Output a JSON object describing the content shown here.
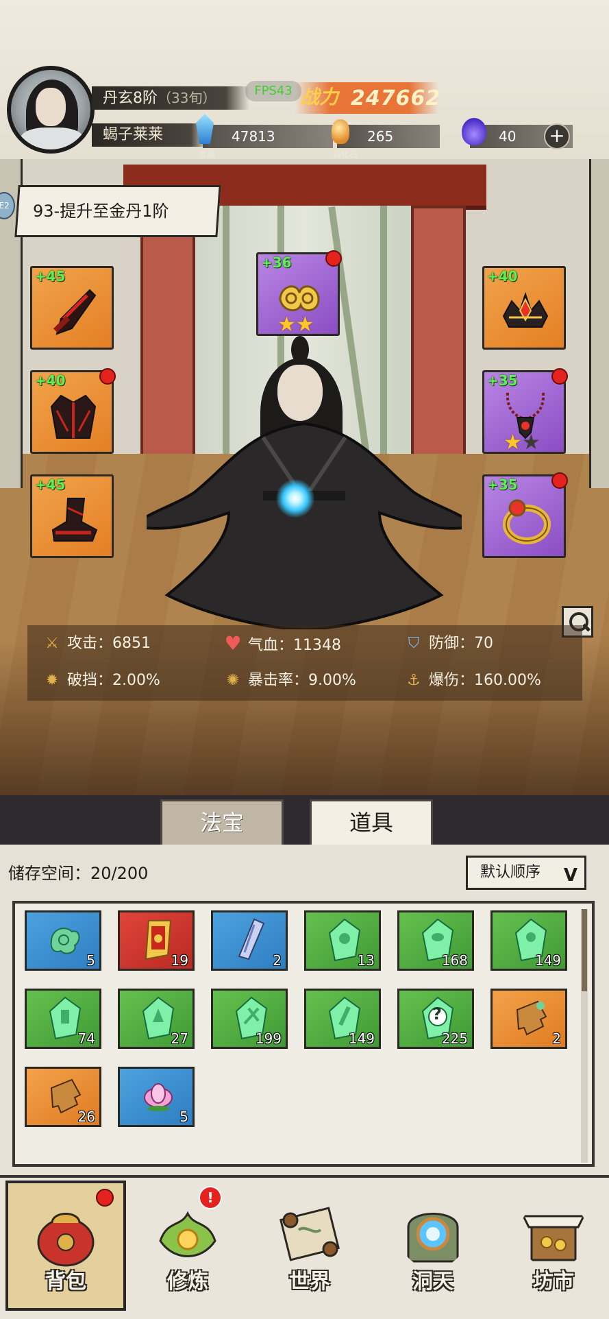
{
  "header": {
    "realm": "丹玄8阶",
    "age": "（33旬）",
    "nickname": "蝎子莱莱",
    "fps": "FPS43",
    "power_label": "战力",
    "power_value": "247662",
    "resources": [
      {
        "name": "灵晶",
        "value": "47813",
        "icon": "spirit-crystal-icon"
      },
      {
        "name": "造化石",
        "value": "265",
        "icon": "creation-stone-icon"
      },
      {
        "name": "",
        "value": "40",
        "icon": "purple-flame-icon"
      }
    ],
    "add_label": "+"
  },
  "quest": {
    "text": "93-提升至金丹1阶",
    "side_badge": "E2"
  },
  "equipment": [
    {
      "slot": "weapon",
      "level": "+45",
      "color": "#e9882b",
      "red_dot": false,
      "stars": 0
    },
    {
      "slot": "armor",
      "level": "+40",
      "color": "#e9882b",
      "red_dot": true,
      "stars": 0
    },
    {
      "slot": "boots",
      "level": "+45",
      "color": "#e9882b",
      "red_dot": false,
      "stars": 0
    },
    {
      "slot": "talisman",
      "level": "+36",
      "color": "#9a5fd0",
      "red_dot": true,
      "stars": 2
    },
    {
      "slot": "crown",
      "level": "+40",
      "color": "#e9882b",
      "red_dot": false,
      "stars": 0
    },
    {
      "slot": "necklace",
      "level": "+35",
      "color": "#9a5fd0",
      "red_dot": true,
      "stars": 1
    },
    {
      "slot": "ring",
      "level": "+35",
      "color": "#9a5fd0",
      "red_dot": true,
      "stars": 0
    }
  ],
  "stats": [
    {
      "label": "攻击：",
      "value": "6851",
      "icon": "sword-icon"
    },
    {
      "label": "气血：",
      "value": "11348",
      "icon": "heart-icon"
    },
    {
      "label": "防御：",
      "value": "70",
      "icon": "shield-icon"
    },
    {
      "label": "破挡：",
      "value": "2.00%",
      "icon": "break-icon"
    },
    {
      "label": "暴击率：",
      "value": "9.00%",
      "icon": "crit-icon"
    },
    {
      "label": "爆伤：",
      "value": "160.00%",
      "icon": "crit-damage-icon"
    }
  ],
  "tabs": [
    {
      "label": "法宝",
      "active": false
    },
    {
      "label": "道具",
      "active": true
    }
  ],
  "inventory": {
    "storage_label": "储存空间：",
    "storage_value": "20/200",
    "sort_label": "默认顺序",
    "items": [
      {
        "color": "blue",
        "count": "5",
        "icon": "jade-cloud-icon"
      },
      {
        "color": "red",
        "count": "19",
        "icon": "scroll-seal-icon"
      },
      {
        "color": "blue",
        "count": "2",
        "icon": "blade-icon"
      },
      {
        "color": "green",
        "count": "13",
        "icon": "green-gem-icon"
      },
      {
        "color": "green",
        "count": "168",
        "icon": "green-gem-icon"
      },
      {
        "color": "green",
        "count": "149",
        "icon": "green-gem-icon"
      },
      {
        "color": "green",
        "count": "74",
        "icon": "green-gem-icon"
      },
      {
        "color": "green",
        "count": "27",
        "icon": "green-gem-icon"
      },
      {
        "color": "green",
        "count": "199",
        "icon": "green-gem-icon"
      },
      {
        "color": "green",
        "count": "149",
        "icon": "green-gem-icon"
      },
      {
        "color": "green",
        "count": "225",
        "icon": "mystery-gem-icon",
        "glyph": "?"
      },
      {
        "color": "orange",
        "count": "2",
        "icon": "puzzle-piece-icon"
      },
      {
        "color": "orange",
        "count": "26",
        "icon": "puzzle-piece-icon"
      },
      {
        "color": "blue",
        "count": "5",
        "icon": "lotus-icon"
      }
    ]
  },
  "nav": [
    {
      "label": "背包",
      "icon": "bag-icon",
      "active": true,
      "dot": true,
      "alert": false
    },
    {
      "label": "修炼",
      "icon": "cultivation-icon",
      "active": false,
      "dot": false,
      "alert": true,
      "alert_text": "!"
    },
    {
      "label": "世界",
      "icon": "world-scroll-icon",
      "active": false,
      "dot": false,
      "alert": false
    },
    {
      "label": "洞天",
      "icon": "cave-portal-icon",
      "active": false,
      "dot": false,
      "alert": false
    },
    {
      "label": "坊市",
      "icon": "market-stall-icon",
      "active": false,
      "dot": false,
      "alert": false
    }
  ]
}
